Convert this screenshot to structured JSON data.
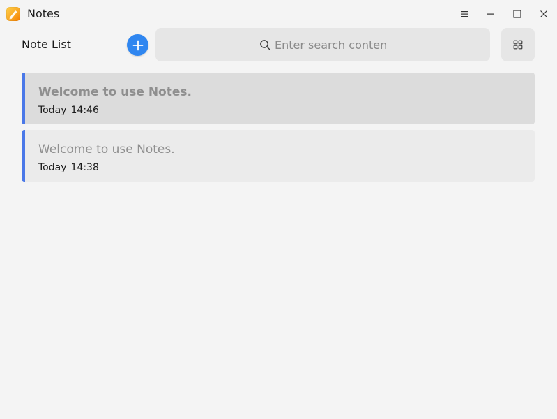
{
  "window": {
    "title": "Notes",
    "icons": {
      "app": "notes-app-icon",
      "menu": "menu-icon",
      "minimize": "minimize-icon",
      "maximize": "maximize-icon",
      "close": "close-icon"
    }
  },
  "toolbar": {
    "note_list_label": "Note List",
    "add_icon": "plus-icon",
    "search": {
      "placeholder": "Enter search content",
      "value": "",
      "icon": "search-icon"
    },
    "view_icon": "grid-view-icon"
  },
  "notes": [
    {
      "title": "Welcome to use Notes.",
      "day": "Today",
      "time": "14:46",
      "selected": true
    },
    {
      "title": "Welcome to use Notes.",
      "day": "Today",
      "time": "14:38",
      "selected": false
    }
  ],
  "colors": {
    "accent": "#2f86f0",
    "note_accent": "#4a78e8",
    "background": "#f4f4f4"
  }
}
